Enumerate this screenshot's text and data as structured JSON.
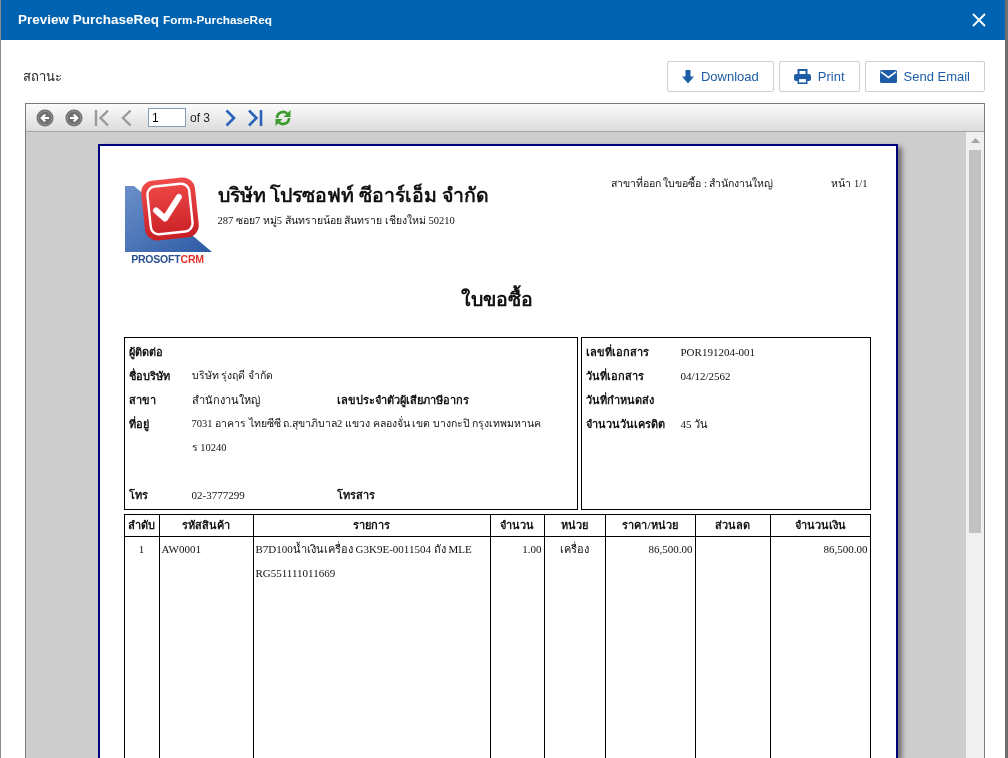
{
  "window": {
    "title": "Preview PurchaseReq",
    "subtitle": "Form-PurchaseReq"
  },
  "status": {
    "label": "สถานะ"
  },
  "actions": [
    {
      "kind": "download",
      "label": "Download"
    },
    {
      "kind": "print",
      "label": "Print"
    },
    {
      "kind": "email",
      "label": "Send Email"
    }
  ],
  "viewer": {
    "toolbar": [
      {
        "kind": "back",
        "disabled": false
      },
      {
        "kind": "forward",
        "disabled": false
      },
      {
        "kind": "first",
        "disabled": true
      },
      {
        "kind": "previous",
        "disabled": true
      },
      {
        "kind": "page",
        "disabled": false,
        "value": "1",
        "total": "of 3"
      },
      {
        "kind": "next",
        "disabled": false
      },
      {
        "kind": "last",
        "disabled": false
      },
      {
        "kind": "refresh",
        "disabled": false
      }
    ],
    "report": {
      "logo": {
        "text_1": "PROSOFT",
        "text_2": "CRM"
      },
      "company": {
        "name": "บริษัท โปรซอฟท์ ซีอาร์เอ็ม จำกัด",
        "address": "287 ซอย7 หมู่5 สันทรายน้อย สันทราย เชียงใหม่ 50210"
      },
      "branch_note": "สาขาที่ออก ใบขอซื้อ : สำนักงานใหญ่",
      "page_note": "หน้า 1/1",
      "title": "ใบขอซื้อ",
      "contact": [
        {
          "label": "ผู้ติดต่อ"
        },
        {
          "label": "ชื่อบริษัท",
          "value": "บริษัท รุ่งฤดี จำกัด"
        },
        {
          "label": "สาขา",
          "value": "สำนักงานใหญ่",
          "label_2": "เลขประจำตัวผู้เสียภาษีอากร"
        },
        {
          "label": "ที่อยู่",
          "value_lines": [
            "7031 อาคาร ไทยซีซี ถ.สุขาภิบาล2 แขวง คลองจั่น เขต บางกะปิ กรุงเทพมหานค",
            "ร 10240"
          ]
        },
        {
          "label": "โทร",
          "value": "02-3777299",
          "label_2": "โทรสาร"
        }
      ],
      "document": [
        {
          "label": "เลขที่เอกสาร",
          "value": "POR191204-001"
        },
        {
          "label": "วันที่เอกสาร",
          "value": "04/12/2562"
        },
        {
          "label": "วันที่กำหนดส่ง"
        },
        {
          "label": "จำนวนวันเครดิต",
          "value": "45 วัน"
        }
      ],
      "table": {
        "columns": [
          "ลำดับ",
          "รหัสสินค้า",
          "รายการ",
          "จำนวน",
          "หน่วย",
          "ราคา/หน่วย",
          "ส่วนลด",
          "จำนวนเงิน"
        ],
        "rows": [
          {
            "no": "1",
            "code": "AW0001",
            "description": "B7D100น้ำเงินเครื่อง G3K9E-0011504 ถัง MLE RG551111011669",
            "quantity": "1.00",
            "unit": "เครื่อง",
            "unit_price": "86,500.00",
            "amount": "86,500.00"
          }
        ]
      }
    }
  }
}
